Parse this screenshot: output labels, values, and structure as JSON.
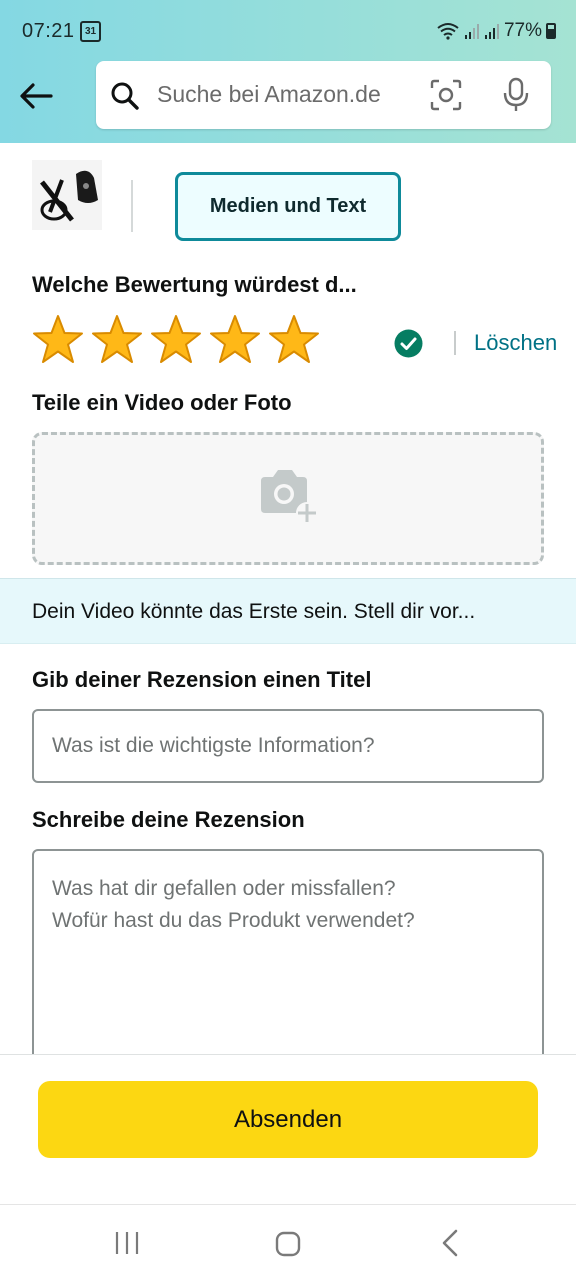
{
  "status_bar": {
    "time": "07:21",
    "calendar_day": "31",
    "battery_percent": "77%"
  },
  "search": {
    "placeholder": "Suche bei Amazon.de"
  },
  "tabs": {
    "media_text_label": "Medien und Text"
  },
  "rating": {
    "question": "Welche Bewertung würdest d...",
    "stars_selected": 5,
    "stars_total": 5,
    "delete_label": "Löschen"
  },
  "media_upload": {
    "label": "Teile ein Video oder Foto",
    "banner_text": "Dein Video könnte das Erste sein. Stell dir vor..."
  },
  "review_title": {
    "label": "Gib deiner Rezension einen Titel",
    "placeholder": "Was ist die wichtigste Information?"
  },
  "review_body": {
    "label": "Schreibe deine Rezension",
    "placeholder": "Was hat dir gefallen oder missfallen?\nWofür hast du das Produkt verwendet?"
  },
  "submit": {
    "label": "Absenden"
  },
  "colors": {
    "header_gradient_start": "#84d8e3",
    "header_gradient_end": "#a5e3d3",
    "accent_teal": "#007185",
    "star_gold": "#ffa41c",
    "submit_yellow": "#fcd712",
    "check_green": "#067d62"
  },
  "icons": [
    "back-arrow-icon",
    "search-icon",
    "camera-lens-icon",
    "microphone-icon",
    "star-icon",
    "check-circle-icon",
    "add-photo-icon",
    "recents-icon",
    "home-icon",
    "nav-back-icon"
  ]
}
